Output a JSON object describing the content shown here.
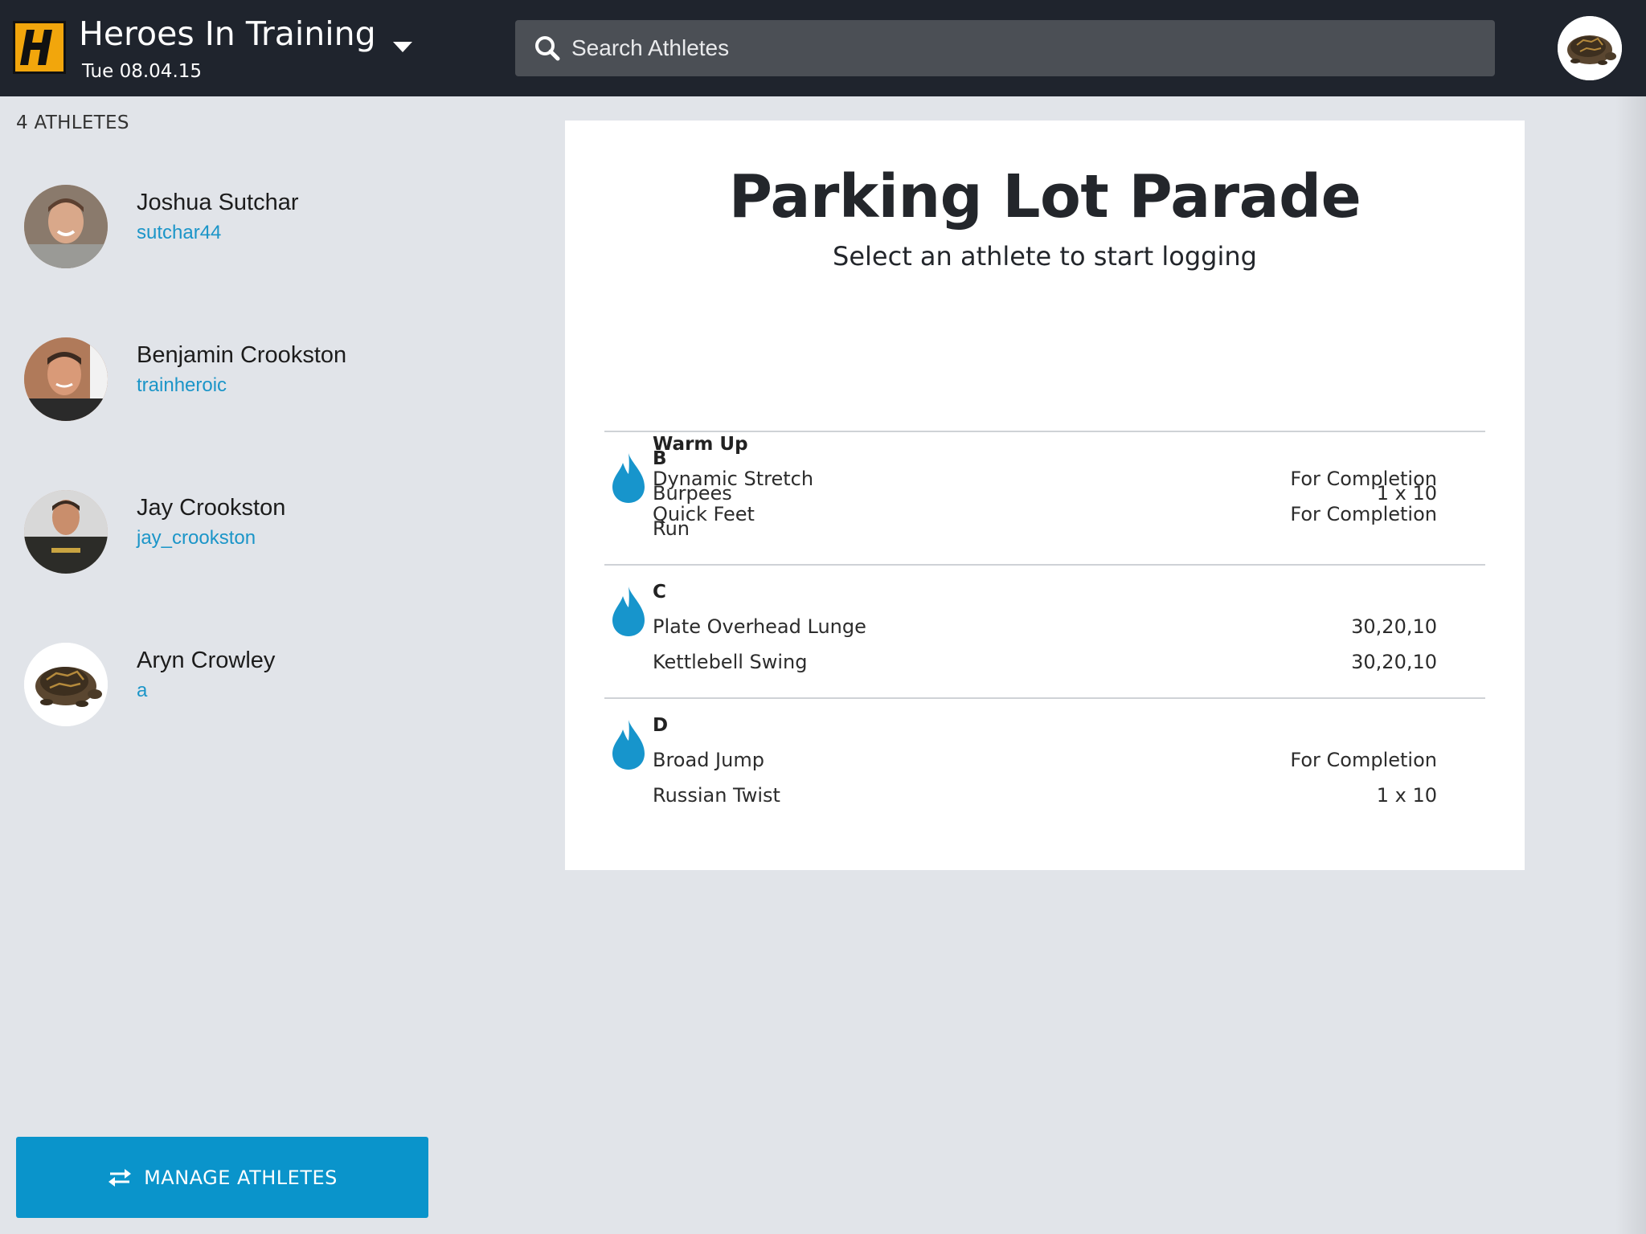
{
  "header": {
    "team_name": "Heroes In Training",
    "date": "Tue 08.04.15",
    "logo_letter": "H",
    "search": {
      "placeholder": "Search Athletes",
      "value": ""
    },
    "user_avatar_icon": "turtle-avatar"
  },
  "sidebar": {
    "count_label": "4 ATHLETES",
    "athletes": [
      {
        "name": "Joshua Sutchar",
        "username": "sutchar44"
      },
      {
        "name": "Benjamin Crookston",
        "username": "trainheroic"
      },
      {
        "name": "Jay Crookston",
        "username": "jay_crookston"
      },
      {
        "name": "Aryn Crowley",
        "username": "a"
      }
    ],
    "manage_button": {
      "label": "MANAGE ATHLETES",
      "icon": "swap-arrows-icon"
    }
  },
  "workout": {
    "title": "Parking Lot Parade",
    "subtitle": "Select an athlete to start logging",
    "blocks": [
      {
        "label": "Warm Up",
        "intensity_icon": false,
        "exercises": [
          {
            "name": "Dynamic Stretch",
            "value": "For Completion"
          },
          {
            "name": "Quick Feet",
            "value": "For Completion"
          }
        ]
      },
      {
        "label": "B",
        "intensity_icon": true,
        "exercises": [
          {
            "name": "Burpees",
            "value": "1 x 10"
          },
          {
            "name": "Run",
            "value": ""
          }
        ]
      },
      {
        "label": "C",
        "intensity_icon": true,
        "exercises": [
          {
            "name": "Plate Overhead Lunge",
            "value": "30,20,10"
          },
          {
            "name": "Kettlebell Swing",
            "value": "30,20,10"
          }
        ]
      },
      {
        "label": "D",
        "intensity_icon": true,
        "exercises": [
          {
            "name": "Broad Jump",
            "value": "For Completion"
          },
          {
            "name": "Russian Twist",
            "value": "1 x 10"
          }
        ]
      }
    ]
  },
  "colors": {
    "header_bg": "#1f242d",
    "page_bg": "#e1e4e9",
    "accent": "#0a94cb",
    "logo": "#f2a60c",
    "link": "#1b95c8"
  }
}
